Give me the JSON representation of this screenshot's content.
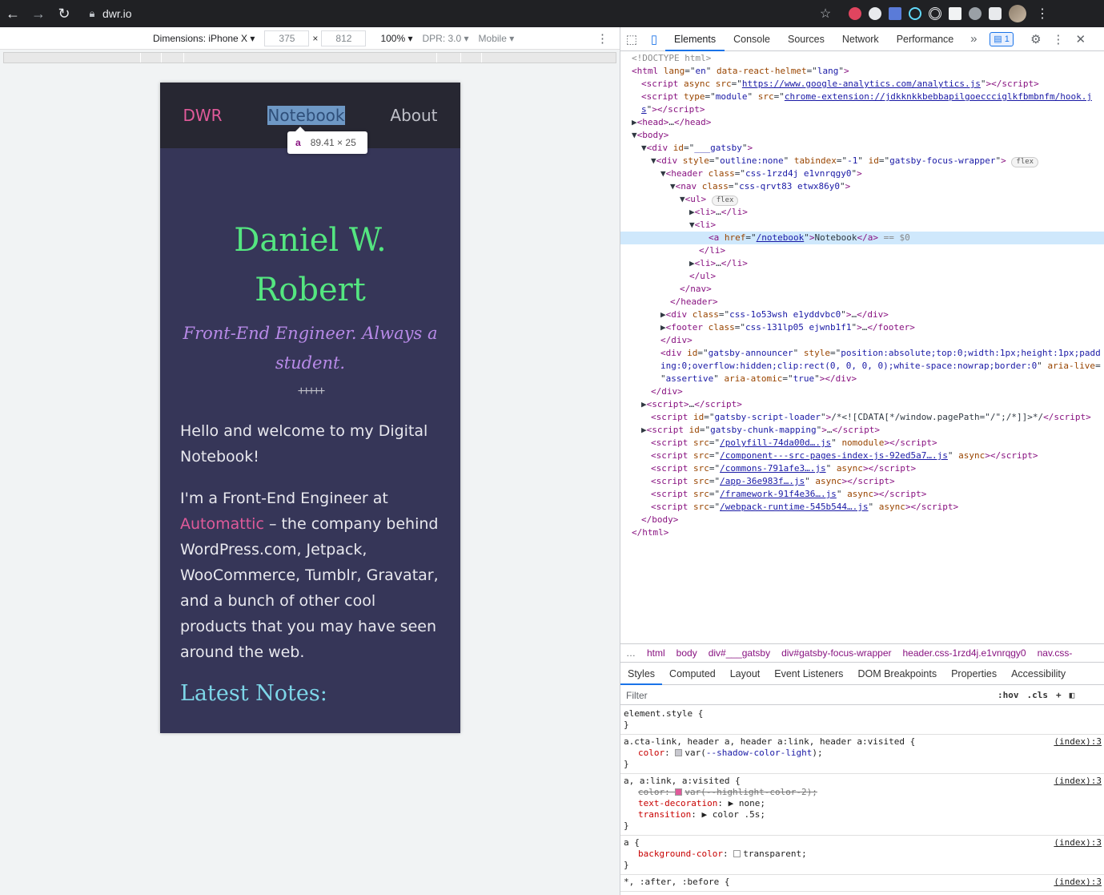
{
  "browser": {
    "url": "dwr.io",
    "colors": {
      "toolbar": "#202124"
    }
  },
  "device_toolbar": {
    "dimensions_label": "Dimensions: iPhone X",
    "width": "375",
    "height": "812",
    "zoom": "100%",
    "dpr": "DPR: 3.0",
    "throttle": "Mobile"
  },
  "site": {
    "logo": "DWR",
    "nav": [
      "Notebook",
      "About"
    ],
    "name": "Daniel W. Robert",
    "tagline": "Front-End Engineer. Always a student.",
    "divider": "+++++",
    "intro": "Hello and welcome to my Digital Notebook!",
    "about_prefix": "I'm a Front-End Engineer at",
    "about_link": "Automattic",
    "about_suffix": "– the company behind WordPress.com, Jetpack, WooCommerce, Tumblr, Gravatar, and a bunch of other cool products that you may have seen around the web.",
    "latest": "Latest Notes:",
    "colors": {
      "bg": "#363658",
      "header": "#272732",
      "name": "#54e680",
      "tagline": "#b88ae8",
      "link": "#e05a9a",
      "heading": "#7dd6e8"
    }
  },
  "tooltip": {
    "tag": "a",
    "size": "89.41 × 25"
  },
  "devtools": {
    "tabs": [
      "Elements",
      "Console",
      "Sources",
      "Network",
      "Performance"
    ],
    "issues_count": "1",
    "dom": [
      {
        "i": 0,
        "h": "<span class='cm'>&lt;!DOCTYPE html&gt;</span>"
      },
      {
        "i": 0,
        "h": "<span class='tag'>&lt;html</span> <span class='attr'>lang</span>=\"<span class='val'>en</span>\" <span class='attr'>data-react-helmet</span>=\"<span class='val'>lang</span>\"<span class='tag'>&gt;</span>"
      },
      {
        "i": 1,
        "h": "<span class='tag'>&lt;script</span> <span class='attr'>async</span> <span class='attr'>src</span>=\"<span class='link'>https://www.google-analytics.com/analytics.js</span>\"<span class='tag'>&gt;&lt;/script&gt;</span>"
      },
      {
        "i": 1,
        "h": "<span class='tag'>&lt;script</span> <span class='attr'>type</span>=\"<span class='val'>module</span>\" <span class='attr'>src</span>=\"<span class='link'>chrome-extension://jdkknkkbebbapilgoeccciglkfbmbnfm/hook.j</span>"
      },
      {
        "i": 1,
        "h": "<span class='link'>s</span>\"<span class='tag'>&gt;&lt;/script&gt;</span>"
      },
      {
        "i": 0,
        "h": "▶<span class='tag'>&lt;head&gt;</span>…<span class='tag'>&lt;/head&gt;</span>"
      },
      {
        "i": 0,
        "h": "▼<span class='tag'>&lt;body&gt;</span>"
      },
      {
        "i": 1,
        "h": "▼<span class='tag'>&lt;div</span> <span class='attr'>id</span>=\"<span class='val'>___gatsby</span>\"<span class='tag'>&gt;</span>"
      },
      {
        "i": 2,
        "h": "▼<span class='tag'>&lt;div</span> <span class='attr'>style</span>=\"<span class='val'>outline:none</span>\" <span class='attr'>tabindex</span>=\"<span class='val'>-1</span>\" <span class='attr'>id</span>=\"<span class='val'>gatsby-focus-wrapper</span>\"<span class='tag'>&gt;</span> <span class='pill'>flex</span>"
      },
      {
        "i": 3,
        "h": "▼<span class='tag'>&lt;header</span> <span class='attr'>class</span>=\"<span class='val'>css-1rzd4j e1vnrqgy0</span>\"<span class='tag'>&gt;</span>"
      },
      {
        "i": 4,
        "h": "▼<span class='tag'>&lt;nav</span> <span class='attr'>class</span>=\"<span class='val'>css-qrvt83 etwx86y0</span>\"<span class='tag'>&gt;</span>"
      },
      {
        "i": 5,
        "h": "▼<span class='tag'>&lt;ul&gt;</span> <span class='pill'>flex</span>"
      },
      {
        "i": 6,
        "h": "▶<span class='tag'>&lt;li&gt;</span>…<span class='tag'>&lt;/li&gt;</span>"
      },
      {
        "i": 6,
        "h": "▼<span class='tag'>&lt;li&gt;</span>"
      },
      {
        "i": 8,
        "h": "<span class='tag'>&lt;a</span> <span class='attr'>href</span>=\"<span class='link'>/notebook</span>\"<span class='tag'>&gt;</span>Notebook<span class='tag'>&lt;/a&gt;</span> <span class='muted'>== $0</span>",
        "sel": true
      },
      {
        "i": 7,
        "h": "<span class='tag'>&lt;/li&gt;</span>"
      },
      {
        "i": 6,
        "h": "▶<span class='tag'>&lt;li&gt;</span>…<span class='tag'>&lt;/li&gt;</span>"
      },
      {
        "i": 6,
        "h": "<span class='tag'>&lt;/ul&gt;</span>"
      },
      {
        "i": 5,
        "h": "<span class='tag'>&lt;/nav&gt;</span>"
      },
      {
        "i": 4,
        "h": "<span class='tag'>&lt;/header&gt;</span>"
      },
      {
        "i": 3,
        "h": "▶<span class='tag'>&lt;div</span> <span class='attr'>class</span>=\"<span class='val'>css-1o53wsh e1yddvbc0</span>\"<span class='tag'>&gt;</span>…<span class='tag'>&lt;/div&gt;</span>"
      },
      {
        "i": 3,
        "h": "▶<span class='tag'>&lt;footer</span> <span class='attr'>class</span>=\"<span class='val'>css-131lp05 ejwnb1f1</span>\"<span class='tag'>&gt;</span>…<span class='tag'>&lt;/footer&gt;</span>"
      },
      {
        "i": 3,
        "h": "<span class='tag'>&lt;/div&gt;</span>"
      },
      {
        "i": 3,
        "h": "<span class='tag'>&lt;div</span> <span class='attr'>id</span>=\"<span class='val'>gatsby-announcer</span>\" <span class='attr'>style</span>=\"<span class='val'>position:absolute;top:0;width:1px;height:1px;padd</span>"
      },
      {
        "i": 3,
        "h": "<span class='val'>ing:0;overflow:hidden;clip:rect(0, 0, 0, 0);white-space:nowrap;border:0</span>\" <span class='attr'>aria-live</span>="
      },
      {
        "i": 3,
        "h": "\"<span class='val'>assertive</span>\" <span class='attr'>aria-atomic</span>=\"<span class='val'>true</span>\"<span class='tag'>&gt;&lt;/div&gt;</span>"
      },
      {
        "i": 2,
        "h": "<span class='tag'>&lt;/div&gt;</span>"
      },
      {
        "i": 1,
        "h": "▶<span class='tag'>&lt;script&gt;</span>…<span class='tag'>&lt;/script&gt;</span>"
      },
      {
        "i": 2,
        "h": "<span class='tag'>&lt;script</span> <span class='attr'>id</span>=\"<span class='val'>gatsby-script-loader</span>\"<span class='tag'>&gt;</span>/*&lt;![CDATA[*/window.pagePath=\"/\";/*]]&gt;*/<span class='tag'>&lt;/script&gt;</span>"
      },
      {
        "i": 1,
        "h": "▶<span class='tag'>&lt;script</span> <span class='attr'>id</span>=\"<span class='val'>gatsby-chunk-mapping</span>\"<span class='tag'>&gt;</span>…<span class='tag'>&lt;/script&gt;</span>"
      },
      {
        "i": 2,
        "h": "<span class='tag'>&lt;script</span> <span class='attr'>src</span>=\"<span class='link'>/polyfill-74da00d….js</span>\" <span class='attr'>nomodule</span><span class='tag'>&gt;&lt;/script&gt;</span>"
      },
      {
        "i": 2,
        "h": "<span class='tag'>&lt;script</span> <span class='attr'>src</span>=\"<span class='link'>/component---src-pages-index-js-92ed5a7….js</span>\" <span class='attr'>async</span><span class='tag'>&gt;&lt;/script&gt;</span>"
      },
      {
        "i": 2,
        "h": "<span class='tag'>&lt;script</span> <span class='attr'>src</span>=\"<span class='link'>/commons-791afe3….js</span>\" <span class='attr'>async</span><span class='tag'>&gt;&lt;/script&gt;</span>"
      },
      {
        "i": 2,
        "h": "<span class='tag'>&lt;script</span> <span class='attr'>src</span>=\"<span class='link'>/app-36e983f….js</span>\" <span class='attr'>async</span><span class='tag'>&gt;&lt;/script&gt;</span>"
      },
      {
        "i": 2,
        "h": "<span class='tag'>&lt;script</span> <span class='attr'>src</span>=\"<span class='link'>/framework-91f4e36….js</span>\" <span class='attr'>async</span><span class='tag'>&gt;&lt;/script&gt;</span>"
      },
      {
        "i": 2,
        "h": "<span class='tag'>&lt;script</span> <span class='attr'>src</span>=\"<span class='link'>/webpack-runtime-545b544….js</span>\" <span class='attr'>async</span><span class='tag'>&gt;&lt;/script&gt;</span>"
      },
      {
        "i": 1,
        "h": "<span class='tag'>&lt;/body&gt;</span>"
      },
      {
        "i": 0,
        "h": "<span class='tag'>&lt;/html&gt;</span>"
      }
    ],
    "breadcrumbs": [
      "html",
      "body",
      "div#___gatsby",
      "div#gatsby-focus-wrapper",
      "header.css-1rzd4j.e1vnrqgy0",
      "nav.css-"
    ],
    "subtabs": [
      "Styles",
      "Computed",
      "Layout",
      "Event Listeners",
      "DOM Breakpoints",
      "Properties",
      "Accessibility"
    ],
    "filter_placeholder": "Filter",
    "filter_tools": [
      ":hov",
      ".cls"
    ],
    "styles": [
      {
        "selector": "element.style {",
        "src": "",
        "props": []
      },
      {
        "selector": "a.cta-link, header a, header a:link, header a:visited {",
        "src": "(index):3",
        "props": [
          {
            "h": "<span class='pname'>color</span>: <span class='sw' style='background:#c8c8cf'></span>var(<span class='val'>--shadow-color-light</span>);"
          }
        ]
      },
      {
        "selector": "a, a:link, a:visited {",
        "src": "(index):3",
        "props": [
          {
            "h": "<span class='strike'>color: <span class='sw' style='background:#e05a9a'></span>var(--highlight-color-2);</span>"
          },
          {
            "h": "<span class='pname'>text-decoration</span>: ▶ none;"
          },
          {
            "h": "<span class='pname'>transition</span>: ▶ color .5s;"
          }
        ]
      },
      {
        "selector": "a {",
        "src": "(index):3",
        "props": [
          {
            "h": "<span class='pname'>background-color</span>: <span class='sw' style='background:#fff'></span>transparent;"
          }
        ]
      },
      {
        "selector": "*, :after, :before {",
        "src": "(index):3",
        "props": []
      }
    ]
  }
}
